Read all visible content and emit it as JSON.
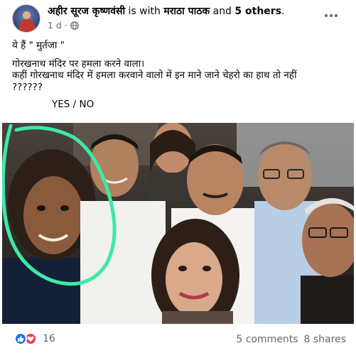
{
  "header": {
    "author": "अहीर सूरज कृष्णवंसी",
    "with_text": "is with",
    "tagged": "मराठा पाठक",
    "and_text": "and",
    "others": "5 others",
    "period": ".",
    "time": "1 d",
    "separator": "·"
  },
  "post": {
    "lines": [
      "ये हैं \" मुर्तजा \"",
      "गोरखनाथ मंदिर पर हमला करने वाला।",
      "कहीं गोरखनाथ मंदिर में हमला करवाने वालो में इन माने जाने चेहरो का हाथ तो नहीं",
      "??????"
    ],
    "yes_no": "YES / NO"
  },
  "icons": {
    "globe": "globe-icon",
    "more": "more-options-icon",
    "like": "like-reaction-icon",
    "love": "love-reaction-icon"
  },
  "footer": {
    "reaction_count": "16",
    "comments": "5 comments",
    "shares": "8 shares"
  },
  "colors": {
    "highlight_circle": "#3ee8a8",
    "like_blue": "#1877f2",
    "love_red": "#f33e58",
    "muted": "#65676b"
  }
}
